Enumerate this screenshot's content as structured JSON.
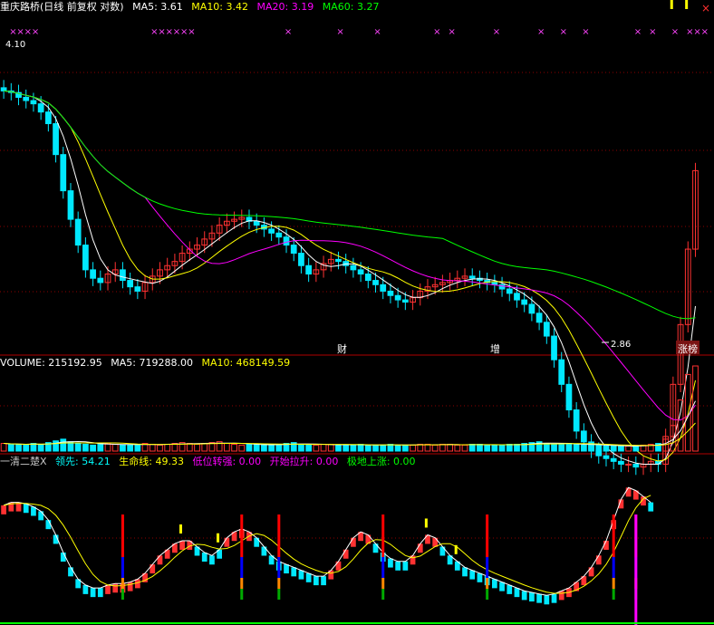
{
  "stock": {
    "name": "重庆路桥",
    "mode": "(日线 前复权 对数)"
  },
  "main_ma": [
    {
      "label": "MA5: 3.61",
      "color": "#ffffff"
    },
    {
      "label": "MA10: 3.42",
      "color": "#ffff00"
    },
    {
      "label": "MA20: 3.19",
      "color": "#ff00ff"
    },
    {
      "label": "MA60: 3.27",
      "color": "#00ff00"
    }
  ],
  "vol_legend": [
    {
      "label": "VOLUME: 215192.95",
      "color": "#ffffff"
    },
    {
      "label": "MA5: 719288.00",
      "color": "#ffffff"
    },
    {
      "label": "MA10: 468149.59",
      "color": "#ffff00"
    }
  ],
  "ind_legend": [
    {
      "label": "一清二楚X",
      "color": "#c8c8c8"
    },
    {
      "label": "领先: 54.21",
      "color": "#00ffff"
    },
    {
      "label": "生命线: 49.33",
      "color": "#ffff00"
    },
    {
      "label": "低位转强: 0.00",
      "color": "#ff00ff"
    },
    {
      "label": "开始拉升: 0.00",
      "color": "#ff00ff"
    },
    {
      "label": "极地上涨: 0.00",
      "color": "#00ff00"
    }
  ],
  "annotations": {
    "high_price": "4.10",
    "low_price": "2.86",
    "tag_cai": "财",
    "tag_zeng": "增",
    "tag_zhang": "涨榜"
  },
  "close_icon": "×",
  "colors": {
    "up": "#ff3232",
    "down": "#00e8ff",
    "ma5": "#ffffff",
    "ma10": "#ffff00",
    "ma20": "#ff00ff",
    "ma60": "#00ff00",
    "grid": "#8b0000"
  },
  "chart_data": [
    {
      "type": "candlestick",
      "title": "重庆路桥(日线 前复权 对数)",
      "ylabel": "",
      "price_points_labeled": [
        {
          "label": "4.10",
          "value": 4.1
        },
        {
          "label": "2.86",
          "value": 2.86
        }
      ],
      "closes": [
        4.08,
        4.07,
        4.04,
        4.02,
        4.0,
        3.95,
        3.88,
        3.7,
        3.5,
        3.35,
        3.22,
        3.1,
        3.06,
        3.04,
        3.08,
        3.1,
        3.05,
        3.02,
        3.0,
        3.04,
        3.07,
        3.1,
        3.12,
        3.14,
        3.18,
        3.2,
        3.22,
        3.25,
        3.28,
        3.32,
        3.34,
        3.35,
        3.36,
        3.34,
        3.32,
        3.3,
        3.28,
        3.26,
        3.22,
        3.18,
        3.12,
        3.08,
        3.1,
        3.13,
        3.15,
        3.14,
        3.12,
        3.1,
        3.08,
        3.05,
        3.03,
        3.0,
        2.98,
        2.96,
        2.95,
        2.97,
        3.0,
        3.02,
        3.03,
        3.04,
        3.05,
        3.06,
        3.07,
        3.06,
        3.05,
        3.04,
        3.03,
        3.01,
        2.99,
        2.96,
        2.94,
        2.9,
        2.86,
        2.8,
        2.7,
        2.6,
        2.5,
        2.42,
        2.38,
        2.35,
        2.33,
        2.32,
        2.31,
        2.3,
        2.3,
        2.29,
        2.3,
        2.31,
        2.3,
        2.4,
        2.6,
        2.85,
        3.2,
        3.61
      ],
      "series": [
        {
          "name": "MA5",
          "value": 3.61
        },
        {
          "name": "MA10",
          "value": 3.42
        },
        {
          "name": "MA20",
          "value": 3.19
        },
        {
          "name": "MA60",
          "value": 3.27
        }
      ]
    },
    {
      "type": "bar",
      "title": "VOLUME",
      "series": [
        {
          "name": "VOLUME",
          "value": 215192.95
        },
        {
          "name": "MA5",
          "value": 719288.0
        },
        {
          "name": "MA10",
          "value": 468149.59
        }
      ],
      "volumes": [
        9,
        8,
        8,
        7,
        9,
        8,
        10,
        12,
        14,
        11,
        9,
        8,
        7,
        8,
        9,
        8,
        7,
        7,
        8,
        9,
        8,
        7,
        8,
        9,
        10,
        9,
        8,
        9,
        10,
        11,
        9,
        8,
        7,
        8,
        8,
        7,
        7,
        8,
        9,
        10,
        8,
        7,
        7,
        8,
        8,
        7,
        7,
        7,
        8,
        7,
        7,
        7,
        8,
        7,
        7,
        7,
        8,
        8,
        7,
        8,
        8,
        7,
        7,
        8,
        8,
        7,
        7,
        7,
        8,
        8,
        9,
        10,
        11,
        9,
        8,
        8,
        9,
        8,
        7,
        7,
        7,
        6,
        6,
        6,
        6,
        6,
        7,
        8,
        9,
        14,
        30,
        60,
        90,
        100
      ]
    },
    {
      "type": "line",
      "title": "一清二楚X",
      "series": [
        {
          "name": "领先",
          "value": 54.21
        },
        {
          "name": "生命线",
          "value": 49.33
        },
        {
          "name": "低位转强",
          "value": 0.0
        },
        {
          "name": "开始拉升",
          "value": 0.0
        },
        {
          "name": "极地上涨",
          "value": 0.0
        }
      ],
      "lead": [
        78,
        80,
        80,
        79,
        77,
        74,
        68,
        58,
        46,
        36,
        28,
        24,
        22,
        22,
        24,
        25,
        25,
        26,
        28,
        32,
        38,
        44,
        48,
        52,
        54,
        54,
        50,
        46,
        44,
        48,
        56,
        60,
        62,
        60,
        56,
        50,
        44,
        40,
        38,
        36,
        34,
        32,
        30,
        30,
        34,
        40,
        48,
        56,
        60,
        58,
        52,
        46,
        42,
        40,
        40,
        44,
        52,
        58,
        56,
        50,
        44,
        40,
        36,
        34,
        32,
        30,
        28,
        26,
        24,
        22,
        20,
        19,
        18,
        17,
        18,
        20,
        22,
        26,
        30,
        36,
        44,
        54,
        68,
        82,
        90,
        88,
        84,
        80
      ]
    }
  ]
}
